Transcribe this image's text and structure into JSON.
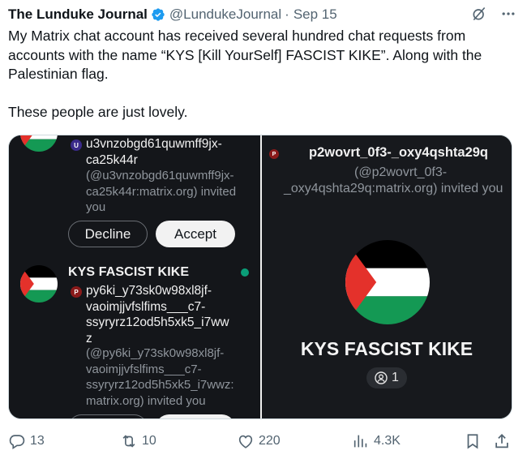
{
  "header": {
    "author": "The Lunduke Journal",
    "handle": "@LundukeJournal",
    "separator": "·",
    "date": "Sep 15",
    "icons": [
      "verified-icon",
      "grok-icon",
      "more-icon"
    ]
  },
  "tweet": {
    "paragraph1": "My Matrix chat account has received several hundred chat requests from accounts with the name “KYS [Kill YourSelf] FASCIST KIKE”.  Along with the Palestinian flag.",
    "paragraph2": "These people are just lovely."
  },
  "media": {
    "left": {
      "item1": {
        "badge": "U",
        "badge_color": "#3a2a8a",
        "id_line1": "u3vnzobgd61quwmff9jx-",
        "id_line2": "ca25k44r",
        "sub_line1": "(@u3vnzobgd61quwmff9jx-",
        "sub_line2": "ca25k44r:matrix.org) invited",
        "sub_line3": "you",
        "decline": "Decline",
        "accept": "Accept"
      },
      "item2": {
        "room_name": "KYS FASCIST KIKE",
        "badge": "P",
        "badge_color": "#8a1a1a",
        "id_line1": "py6ki_y73sk0w98xl8jf-",
        "id_line2": "vaoimjjvfslfims___c7-",
        "id_line3": "ssyryrz12od5h5xk5_i7ww",
        "id_line4": "z",
        "sub_line1": "(@py6ki_y73sk0w98xl8jf-",
        "sub_line2": "vaoimjjvfslfims___c7-",
        "sub_line3": "ssyryrz12od5h5xk5_i7wwz:",
        "sub_line4": "matrix.org) invited you"
      }
    },
    "right": {
      "badge": "P",
      "badge_color": "#8a1a1a",
      "id": "p2wovrt_0f3-_oxy4qshta29q",
      "sub_line1": "(@p2wovrt_0f3-",
      "sub_line2": "_oxy4qshta29q:matrix.org) invited you",
      "room_name": "KYS FASCIST KIKE",
      "members": "1"
    },
    "flag_colors": {
      "black": "#000000",
      "white": "#ffffff",
      "green": "#149954",
      "red": "#e4312b"
    }
  },
  "actions": {
    "replies": "13",
    "reposts": "10",
    "likes": "220",
    "views": "4.3K"
  }
}
